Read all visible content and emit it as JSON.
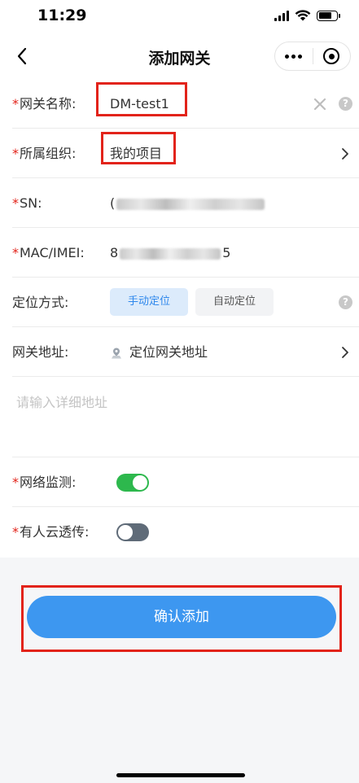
{
  "status_bar": {
    "time": "11:29"
  },
  "nav": {
    "title": "添加网关"
  },
  "form": {
    "gateway_name": {
      "label": "网关名称:",
      "value": "DM-test1",
      "required": true
    },
    "organization": {
      "label": "所属组织:",
      "value": "我的项目",
      "required": true
    },
    "sn": {
      "label": "SN:",
      "value_prefix": "(",
      "required": true
    },
    "mac_imei": {
      "label": "MAC/IMEI:",
      "value_prefix": "8",
      "value_suffix": "5",
      "required": true
    },
    "location_method": {
      "label": "定位方式:",
      "options": [
        "手动定位",
        "自动定位"
      ],
      "selected": "手动定位"
    },
    "gateway_address": {
      "label": "网关地址:",
      "button_label": "定位网关地址"
    },
    "address_detail": {
      "placeholder": "请输入详细地址"
    },
    "network_monitor": {
      "label": "网络监测:",
      "on": true,
      "required": true
    },
    "cloud_passthrough": {
      "label": "有人云透传:",
      "on": false,
      "required": true
    }
  },
  "actions": {
    "confirm_label": "确认添加"
  },
  "colors": {
    "primary": "#3d97f0",
    "required": "#e2231a",
    "toggle_on": "#2db84d",
    "toggle_off": "#5f6b78",
    "highlight": "#e2231a"
  }
}
